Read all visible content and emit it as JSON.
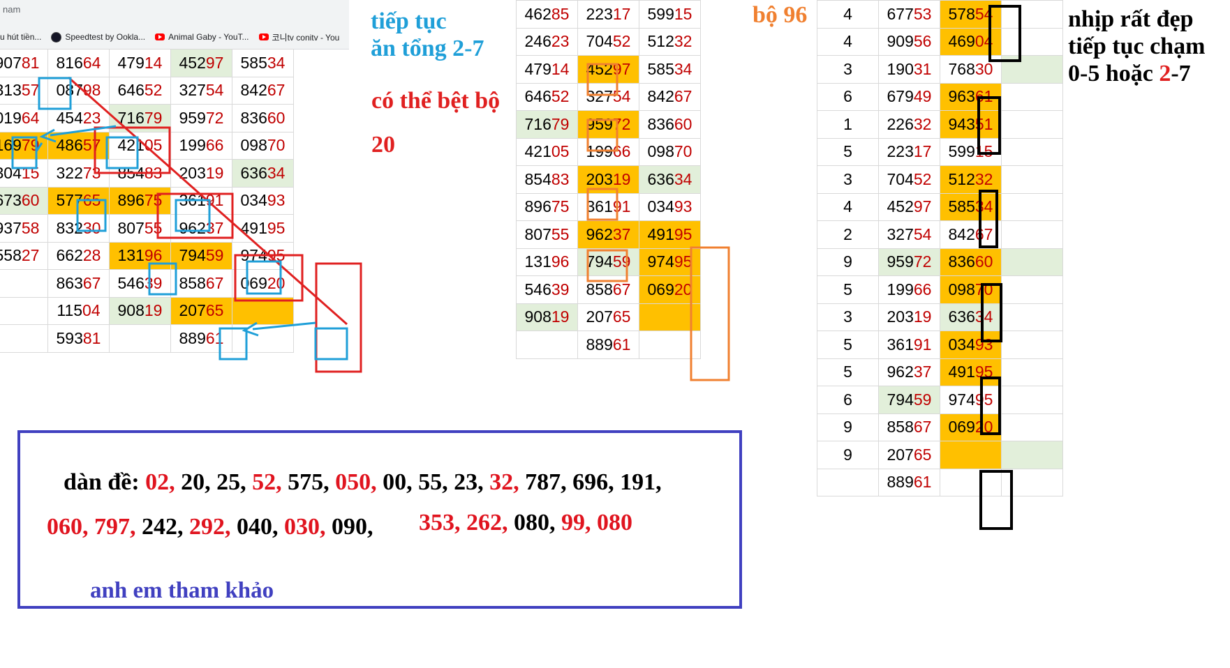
{
  "browser": {
    "tab_text": "nam",
    "bookmarks": [
      {
        "label": "u hút tiền...",
        "icon": "none"
      },
      {
        "label": "Speedtest by Ookla...",
        "icon": "speedtest-icon"
      },
      {
        "label": "Animal Gaby - YouT...",
        "icon": "youtube-icon"
      },
      {
        "label": "코니tv conitv - You",
        "icon": "youtube-icon"
      }
    ]
  },
  "table1": {
    "rows": [
      [
        [
          "907",
          "81",
          "e"
        ],
        [
          "816",
          "64",
          "e"
        ],
        [
          "479",
          "14",
          "e"
        ],
        [
          "452",
          "97",
          "g"
        ],
        [
          "585",
          "34",
          "e"
        ]
      ],
      [
        [
          "313",
          "57",
          "e"
        ],
        [
          "087",
          "98",
          "e"
        ],
        [
          "646",
          "52",
          "e"
        ],
        [
          "327",
          "54",
          "e"
        ],
        [
          "842",
          "67",
          "e"
        ]
      ],
      [
        [
          "019",
          "64",
          "e"
        ],
        [
          "454",
          "23",
          "e"
        ],
        [
          "716",
          "79",
          "g"
        ],
        [
          "959",
          "72",
          "e"
        ],
        [
          "836",
          "60",
          "e"
        ]
      ],
      [
        [
          "169",
          "79",
          "y"
        ],
        [
          "486",
          "57",
          "y"
        ],
        [
          "421",
          "05",
          "e"
        ],
        [
          "199",
          "66",
          "e"
        ],
        [
          "098",
          "70",
          "e"
        ]
      ],
      [
        [
          "304",
          "15",
          "e"
        ],
        [
          "322",
          "73",
          "e"
        ],
        [
          "854",
          "83",
          "e"
        ],
        [
          "203",
          "19",
          "e"
        ],
        [
          "636",
          "34",
          "g"
        ]
      ],
      [
        [
          "673",
          "60",
          "g"
        ],
        [
          "577",
          "65",
          "y"
        ],
        [
          "896",
          "75",
          "y"
        ],
        [
          "361",
          "91",
          "e"
        ],
        [
          "034",
          "93",
          "e"
        ]
      ],
      [
        [
          "937",
          "58",
          "e"
        ],
        [
          "832",
          "30",
          "e"
        ],
        [
          "807",
          "55",
          "e"
        ],
        [
          "962",
          "37",
          "e"
        ],
        [
          "491",
          "95",
          "e"
        ]
      ],
      [
        [
          "558",
          "27",
          "e"
        ],
        [
          "662",
          "28",
          "e"
        ],
        [
          "131",
          "96",
          "y"
        ],
        [
          "794",
          "59",
          "y"
        ],
        [
          "974",
          "95",
          "e"
        ]
      ],
      [
        [
          "",
          "",
          "e"
        ],
        [
          "863",
          "67",
          "e"
        ],
        [
          "546",
          "39",
          "e"
        ],
        [
          "858",
          "67",
          "e"
        ],
        [
          "069",
          "20",
          "e"
        ]
      ],
      [
        [
          "",
          "",
          "e"
        ],
        [
          "115",
          "04",
          "e"
        ],
        [
          "908",
          "19",
          "g"
        ],
        [
          "207",
          "65",
          "y"
        ],
        [
          "",
          "",
          "y"
        ]
      ],
      [
        [
          "",
          "",
          "e"
        ],
        [
          "593",
          "81",
          "e"
        ],
        [
          "",
          "",
          "e"
        ],
        [
          "889",
          "61",
          "e"
        ],
        [
          "",
          "",
          "e"
        ]
      ]
    ]
  },
  "table2": {
    "rows": [
      [
        [
          "462",
          "85",
          "e"
        ],
        [
          "223",
          "17",
          "e"
        ],
        [
          "599",
          "15",
          "e"
        ]
      ],
      [
        [
          "246",
          "23",
          "e"
        ],
        [
          "704",
          "52",
          "e"
        ],
        [
          "512",
          "32",
          "e"
        ]
      ],
      [
        [
          "479",
          "14",
          "e"
        ],
        [
          "452",
          "97",
          "y"
        ],
        [
          "585",
          "34",
          "e"
        ]
      ],
      [
        [
          "646",
          "52",
          "e"
        ],
        [
          "327",
          "54",
          "e"
        ],
        [
          "842",
          "67",
          "e"
        ]
      ],
      [
        [
          "716",
          "79",
          "g"
        ],
        [
          "959",
          "72",
          "y"
        ],
        [
          "836",
          "60",
          "e"
        ]
      ],
      [
        [
          "421",
          "05",
          "e"
        ],
        [
          "199",
          "66",
          "e"
        ],
        [
          "098",
          "70",
          "e"
        ]
      ],
      [
        [
          "854",
          "83",
          "e"
        ],
        [
          "203",
          "19",
          "y"
        ],
        [
          "636",
          "34",
          "g"
        ]
      ],
      [
        [
          "896",
          "75",
          "e"
        ],
        [
          "361",
          "91",
          "e"
        ],
        [
          "034",
          "93",
          "e"
        ]
      ],
      [
        [
          "807",
          "55",
          "e"
        ],
        [
          "962",
          "37",
          "y"
        ],
        [
          "491",
          "95",
          "y"
        ]
      ],
      [
        [
          "131",
          "96",
          "e"
        ],
        [
          "794",
          "59",
          "g"
        ],
        [
          "974",
          "95",
          "y"
        ]
      ],
      [
        [
          "546",
          "39",
          "e"
        ],
        [
          "858",
          "67",
          "e"
        ],
        [
          "069",
          "20",
          "y"
        ]
      ],
      [
        [
          "908",
          "19",
          "g"
        ],
        [
          "207",
          "65",
          "e"
        ],
        [
          "",
          "",
          "y"
        ]
      ],
      [
        [
          "",
          "",
          "e"
        ],
        [
          "889",
          "61",
          "e"
        ],
        [
          "",
          "",
          "e"
        ]
      ]
    ]
  },
  "table3": {
    "rows": [
      [
        [
          "4",
          "",
          "e"
        ],
        [
          "677",
          "53",
          "e"
        ],
        [
          "578",
          "54",
          "y"
        ],
        [
          "",
          "",
          "e"
        ]
      ],
      [
        [
          "4",
          "",
          "e"
        ],
        [
          "909",
          "56",
          "e"
        ],
        [
          "469",
          "04",
          "y"
        ],
        [
          "",
          "",
          "e"
        ]
      ],
      [
        [
          "3",
          "",
          "e"
        ],
        [
          "190",
          "31",
          "e"
        ],
        [
          "768",
          "30",
          "e"
        ],
        [
          "",
          "",
          "g"
        ]
      ],
      [
        [
          "6",
          "",
          "e"
        ],
        [
          "679",
          "49",
          "e"
        ],
        [
          "963",
          "61",
          "y"
        ],
        [
          "",
          "",
          "e"
        ]
      ],
      [
        [
          "1",
          "",
          "e"
        ],
        [
          "226",
          "32",
          "e"
        ],
        [
          "943",
          "51",
          "y"
        ],
        [
          "",
          "",
          "e"
        ]
      ],
      [
        [
          "5",
          "",
          "e"
        ],
        [
          "223",
          "17",
          "e"
        ],
        [
          "599",
          "15",
          "e"
        ],
        [
          "",
          "",
          "e"
        ]
      ],
      [
        [
          "3",
          "",
          "e"
        ],
        [
          "704",
          "52",
          "e"
        ],
        [
          "512",
          "32",
          "y"
        ],
        [
          "",
          "",
          "e"
        ]
      ],
      [
        [
          "4",
          "",
          "e"
        ],
        [
          "452",
          "97",
          "e"
        ],
        [
          "585",
          "34",
          "y"
        ],
        [
          "",
          "",
          "e"
        ]
      ],
      [
        [
          "2",
          "",
          "e"
        ],
        [
          "327",
          "54",
          "e"
        ],
        [
          "842",
          "67",
          "e"
        ],
        [
          "",
          "",
          "e"
        ]
      ],
      [
        [
          "9",
          "",
          "e"
        ],
        [
          "959",
          "72",
          "g"
        ],
        [
          "836",
          "60",
          "y"
        ],
        [
          "",
          "",
          "g"
        ]
      ],
      [
        [
          "5",
          "",
          "e"
        ],
        [
          "199",
          "66",
          "e"
        ],
        [
          "098",
          "70",
          "y"
        ],
        [
          "",
          "",
          "e"
        ]
      ],
      [
        [
          "3",
          "",
          "e"
        ],
        [
          "203",
          "19",
          "e"
        ],
        [
          "636",
          "34",
          "g"
        ],
        [
          "",
          "",
          "e"
        ]
      ],
      [
        [
          "5",
          "",
          "e"
        ],
        [
          "361",
          "91",
          "e"
        ],
        [
          "034",
          "93",
          "y"
        ],
        [
          "",
          "",
          "e"
        ]
      ],
      [
        [
          "5",
          "",
          "e"
        ],
        [
          "962",
          "37",
          "e"
        ],
        [
          "491",
          "95",
          "y"
        ],
        [
          "",
          "",
          "e"
        ]
      ],
      [
        [
          "6",
          "",
          "e"
        ],
        [
          "794",
          "59",
          "g"
        ],
        [
          "974",
          "95",
          "e"
        ],
        [
          "",
          "",
          "e"
        ]
      ],
      [
        [
          "9",
          "",
          "e"
        ],
        [
          "858",
          "67",
          "e"
        ],
        [
          "069",
          "20",
          "y"
        ],
        [
          "",
          "",
          "e"
        ]
      ],
      [
        [
          "9",
          "",
          "e"
        ],
        [
          "207",
          "65",
          "e"
        ],
        [
          "",
          "",
          "y"
        ],
        [
          "",
          "",
          "g"
        ]
      ],
      [
        [
          "",
          "",
          "e"
        ],
        [
          "889",
          "61",
          "e"
        ],
        [
          "",
          "",
          "e"
        ],
        [
          "",
          "",
          "e"
        ]
      ]
    ]
  },
  "annotations": {
    "continue_line1": "tiếp tục",
    "continue_line2": "ăn tổng 2-7",
    "maybe_line1": "có thể bệt bộ",
    "maybe_line2": "20",
    "bo96": "bộ 96",
    "rhythm_line1": "nhịp rất đẹp",
    "rhythm_line2": "tiếp tục chạm",
    "rhythm_line3_a": "0-5 hoặc ",
    "rhythm_line3_b": "2",
    "rhythm_line3_c": "-7",
    "reference": "anh em tham khảo"
  },
  "dan_de": {
    "prefix": "dàn đề: ",
    "line1": [
      {
        "t": "02, ",
        "c": "red"
      },
      {
        "t": "20, ",
        "c": "blk"
      },
      {
        "t": "25, ",
        "c": "blk"
      },
      {
        "t": "52, ",
        "c": "red"
      },
      {
        "t": "575, ",
        "c": "blk"
      },
      {
        "t": "050, ",
        "c": "red"
      },
      {
        "t": "00, ",
        "c": "blk"
      },
      {
        "t": "55, ",
        "c": "blk"
      },
      {
        "t": "23, ",
        "c": "blk"
      },
      {
        "t": "32, ",
        "c": "red"
      },
      {
        "t": "787, ",
        "c": "blk"
      },
      {
        "t": "696, ",
        "c": "blk"
      },
      {
        "t": "191,",
        "c": "blk"
      }
    ],
    "line2a": [
      {
        "t": "060, ",
        "c": "red"
      },
      {
        "t": "797, ",
        "c": "red"
      },
      {
        "t": "242, ",
        "c": "blk"
      },
      {
        "t": "292, ",
        "c": "red"
      },
      {
        "t": "040, ",
        "c": "blk"
      },
      {
        "t": "030, ",
        "c": "red"
      },
      {
        "t": "090, ",
        "c": "blk"
      }
    ],
    "line2b": [
      {
        "t": "353, ",
        "c": "red"
      },
      {
        "t": "262, ",
        "c": "red"
      },
      {
        "t": "080, ",
        "c": "blk"
      },
      {
        "t": "99, ",
        "c": "red"
      },
      {
        "t": "080",
        "c": "red"
      }
    ]
  },
  "colors": {
    "yellow": "#ffc000",
    "green": "#e2efda",
    "red": "#e0141f",
    "blue": "#1f9fd8",
    "orange": "#f08030",
    "purple": "#4040c0"
  }
}
